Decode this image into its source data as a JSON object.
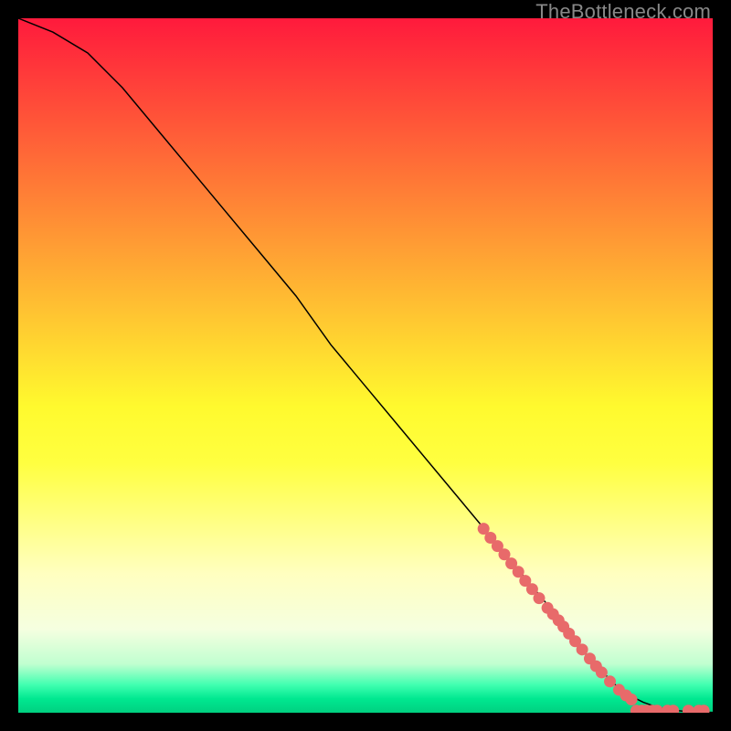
{
  "attribution": "TheBottleneck.com",
  "chart_data": {
    "type": "line",
    "title": "",
    "xlabel": "",
    "ylabel": "",
    "xlim": [
      0,
      100
    ],
    "ylim": [
      0,
      100
    ],
    "curve": {
      "name": "bottleneck-curve",
      "x": [
        0,
        5,
        10,
        15,
        20,
        25,
        30,
        35,
        40,
        45,
        50,
        55,
        60,
        65,
        70,
        75,
        80,
        82,
        84,
        86,
        88,
        90,
        92,
        94,
        96,
        98,
        100
      ],
      "y": [
        100,
        98,
        95,
        90,
        84,
        78,
        72,
        66,
        60,
        53,
        47,
        41,
        35,
        29,
        23,
        17,
        11,
        8,
        6,
        4,
        2.5,
        1.5,
        0.8,
        0.4,
        0.2,
        0.1,
        0.05
      ]
    },
    "scatter": {
      "name": "sample-points",
      "color": "#e86a6a",
      "points": [
        {
          "x": 67,
          "y": 26.5
        },
        {
          "x": 68,
          "y": 25.2
        },
        {
          "x": 69,
          "y": 24.0
        },
        {
          "x": 70,
          "y": 22.8
        },
        {
          "x": 71,
          "y": 21.5
        },
        {
          "x": 72,
          "y": 20.3
        },
        {
          "x": 73,
          "y": 19.0
        },
        {
          "x": 74,
          "y": 17.8
        },
        {
          "x": 75,
          "y": 16.5
        },
        {
          "x": 76.2,
          "y": 15.1
        },
        {
          "x": 77,
          "y": 14.2
        },
        {
          "x": 77.8,
          "y": 13.3
        },
        {
          "x": 78.5,
          "y": 12.4
        },
        {
          "x": 79.3,
          "y": 11.4
        },
        {
          "x": 80.2,
          "y": 10.3
        },
        {
          "x": 81.2,
          "y": 9.1
        },
        {
          "x": 82.3,
          "y": 7.8
        },
        {
          "x": 83.2,
          "y": 6.7
        },
        {
          "x": 84,
          "y": 5.8
        },
        {
          "x": 85.2,
          "y": 4.5
        },
        {
          "x": 86.5,
          "y": 3.3
        },
        {
          "x": 87.5,
          "y": 2.5
        },
        {
          "x": 88.3,
          "y": 1.9
        },
        {
          "x": 89,
          "y": 0.3
        },
        {
          "x": 89.8,
          "y": 0.3
        },
        {
          "x": 90.5,
          "y": 0.3
        },
        {
          "x": 91.3,
          "y": 0.3
        },
        {
          "x": 92,
          "y": 0.3
        },
        {
          "x": 93.5,
          "y": 0.3
        },
        {
          "x": 94.3,
          "y": 0.3
        },
        {
          "x": 96.5,
          "y": 0.3
        },
        {
          "x": 98,
          "y": 0.3
        },
        {
          "x": 98.7,
          "y": 0.3
        }
      ]
    }
  }
}
